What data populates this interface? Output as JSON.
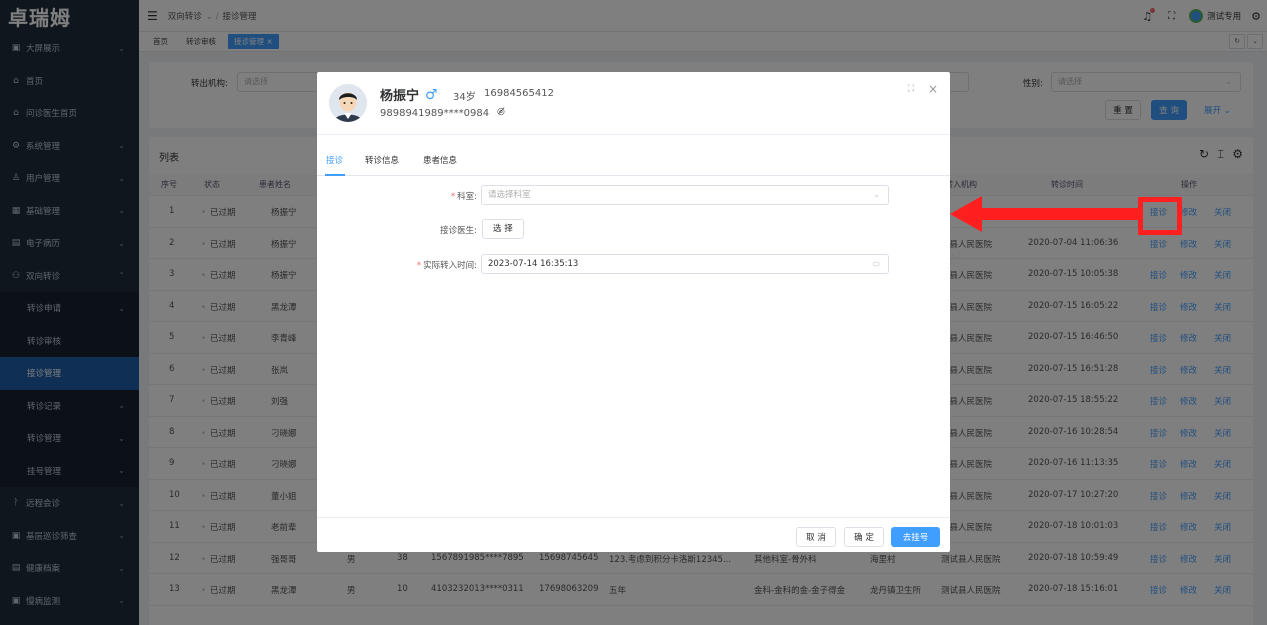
{
  "app": {
    "logo": "卓瑞姆"
  },
  "header": {
    "breadcrumb": [
      "双向转诊",
      "接诊管理"
    ],
    "user": "测试专用"
  },
  "tags": [
    "首页",
    "转诊审核",
    "接诊管理"
  ],
  "sidebar": {
    "items": [
      {
        "icon": "▣",
        "label": "大屏展示",
        "chev": "⌄"
      },
      {
        "icon": "⌂",
        "label": "首页",
        "chev": ""
      },
      {
        "icon": "⌂",
        "label": "问诊医生首页",
        "chev": ""
      },
      {
        "icon": "⚙",
        "label": "系统管理",
        "chev": "⌄"
      },
      {
        "icon": "♙",
        "label": "用户管理",
        "chev": "⌄"
      },
      {
        "icon": "▦",
        "label": "基础管理",
        "chev": "⌄"
      },
      {
        "icon": "▤",
        "label": "电子病历",
        "chev": "⌄"
      },
      {
        "icon": "⚇",
        "label": "双向转诊",
        "chev": "⌃"
      },
      {
        "icon": "",
        "label": "转诊申请",
        "chev": "⌄",
        "sub": true
      },
      {
        "icon": "",
        "label": "转诊审核",
        "chev": "",
        "sub": true
      },
      {
        "icon": "",
        "label": "接诊管理",
        "chev": "",
        "sub": true,
        "active": true
      },
      {
        "icon": "",
        "label": "转诊记录",
        "chev": "⌄",
        "sub": true
      },
      {
        "icon": "",
        "label": "转诊管理",
        "chev": "⌄",
        "sub": true
      },
      {
        "icon": "",
        "label": "挂号管理",
        "chev": "⌄",
        "sub": true
      },
      {
        "icon": "ᚹ",
        "label": "远程会诊",
        "chev": "⌄"
      },
      {
        "icon": "▣",
        "label": "基层巡诊筛查",
        "chev": "⌄"
      },
      {
        "icon": "▤",
        "label": "健康档案",
        "chev": "⌄"
      },
      {
        "icon": "▣",
        "label": "慢病监测",
        "chev": "⌄"
      }
    ]
  },
  "filter": {
    "out_org_label": "转出机构:",
    "out_org_placeholder": "请选择",
    "gender_label": "性别:",
    "gender_placeholder": "请选择",
    "reset": "重 置",
    "search": "查 询",
    "expand": "展开 ⌄"
  },
  "list": {
    "title": "列表",
    "headers": [
      "序号",
      "状态",
      "患者姓名",
      "转入机构",
      "转诊时间",
      "操作"
    ],
    "rows": [
      {
        "no": "1",
        "status": "已过期",
        "name": "杨振宁",
        "gender": "",
        "age": "",
        "id": "",
        "phone": "",
        "diag": "",
        "dept": "",
        "from": "",
        "to": "",
        "time": ""
      },
      {
        "no": "2",
        "status": "已过期",
        "name": "杨振宁",
        "gender": "",
        "age": "",
        "id": "",
        "phone": "",
        "diag": "",
        "dept": "",
        "from": "",
        "to": "试县人民医院",
        "time": "2020-07-04 11:06:36"
      },
      {
        "no": "3",
        "status": "已过期",
        "name": "杨振宁",
        "gender": "",
        "age": "",
        "id": "",
        "phone": "",
        "diag": "",
        "dept": "",
        "from": "",
        "to": "试县人民医院",
        "time": "2020-07-15 10:05:38"
      },
      {
        "no": "4",
        "status": "已过期",
        "name": "黑龙潭",
        "gender": "",
        "age": "",
        "id": "",
        "phone": "",
        "diag": "",
        "dept": "",
        "from": "",
        "to": "试县人民医院",
        "time": "2020-07-15 16:05:22"
      },
      {
        "no": "5",
        "status": "已过期",
        "name": "李青峰",
        "gender": "",
        "age": "",
        "id": "",
        "phone": "",
        "diag": "",
        "dept": "",
        "from": "",
        "to": "试县人民医院",
        "time": "2020-07-15 16:46:50"
      },
      {
        "no": "6",
        "status": "已过期",
        "name": "张岚",
        "gender": "",
        "age": "",
        "id": "",
        "phone": "",
        "diag": "",
        "dept": "",
        "from": "",
        "to": "试县人民医院",
        "time": "2020-07-15 16:51:28"
      },
      {
        "no": "7",
        "status": "已过期",
        "name": "刘强",
        "gender": "",
        "age": "",
        "id": "",
        "phone": "",
        "diag": "",
        "dept": "",
        "from": "",
        "to": "试县人民医院",
        "time": "2020-07-15 18:55:22"
      },
      {
        "no": "8",
        "status": "已过期",
        "name": "刁晓娜",
        "gender": "",
        "age": "",
        "id": "",
        "phone": "",
        "diag": "",
        "dept": "",
        "from": "",
        "to": "试县人民医院",
        "time": "2020-07-16 10:28:54"
      },
      {
        "no": "9",
        "status": "已过期",
        "name": "刁晓娜",
        "gender": "",
        "age": "",
        "id": "",
        "phone": "",
        "diag": "",
        "dept": "",
        "from": "",
        "to": "试县人民医院",
        "time": "2020-07-16 11:13:35"
      },
      {
        "no": "10",
        "status": "已过期",
        "name": "董小姐",
        "gender": "",
        "age": "",
        "id": "",
        "phone": "",
        "diag": "",
        "dept": "",
        "from": "",
        "to": "试县人民医院",
        "time": "2020-07-17 10:27:20"
      },
      {
        "no": "11",
        "status": "已过期",
        "name": "老前辈",
        "gender": "",
        "age": "",
        "id": "",
        "phone": "",
        "diag": "",
        "dept": "",
        "from": "",
        "to": "试县人民医院",
        "time": "2020-07-18 10:01:03"
      },
      {
        "no": "12",
        "status": "已过期",
        "name": "强哥哥",
        "gender": "男",
        "age": "38",
        "id": "1567891985****7895",
        "phone": "15698745645",
        "diag": "123.考虑到积分卡洛斯12345...",
        "dept": "其他科室-骨外科",
        "from": "海里村",
        "to": "测试县人民医院",
        "time": "2020-07-18 10:59:49"
      },
      {
        "no": "13",
        "status": "已过期",
        "name": "黑龙潭",
        "gender": "男",
        "age": "10",
        "id": "4103232013****0311",
        "phone": "17698063209",
        "diag": "五年",
        "dept": "金科-金科的金-金子得金",
        "from": "龙丹镇卫生所",
        "to": "测试县人民医院",
        "time": "2020-07-18 15:16:01"
      }
    ],
    "actions": [
      "接诊",
      "修改",
      "关闭"
    ]
  },
  "modal": {
    "name": "杨振宁",
    "gender_symbol": "♂",
    "age": "34岁",
    "phone": "16984565412",
    "id_masked": "9898941989****0984",
    "tabs": [
      "接诊",
      "转诊信息",
      "患者信息"
    ],
    "form": {
      "dept_label": "科室:",
      "dept_placeholder": "请选择科室",
      "doctor_label": "接诊医生:",
      "doctor_button": "选 择",
      "time_label": "实际转入时间:",
      "time_value": "2023-07-14 16:35:13"
    },
    "footer": {
      "cancel": "取 消",
      "ok": "确 定",
      "register": "去挂号"
    }
  },
  "colors": {
    "primary": "#409eff",
    "sidebar": "#1f2d3d",
    "highlight": "#ff1f1f"
  }
}
